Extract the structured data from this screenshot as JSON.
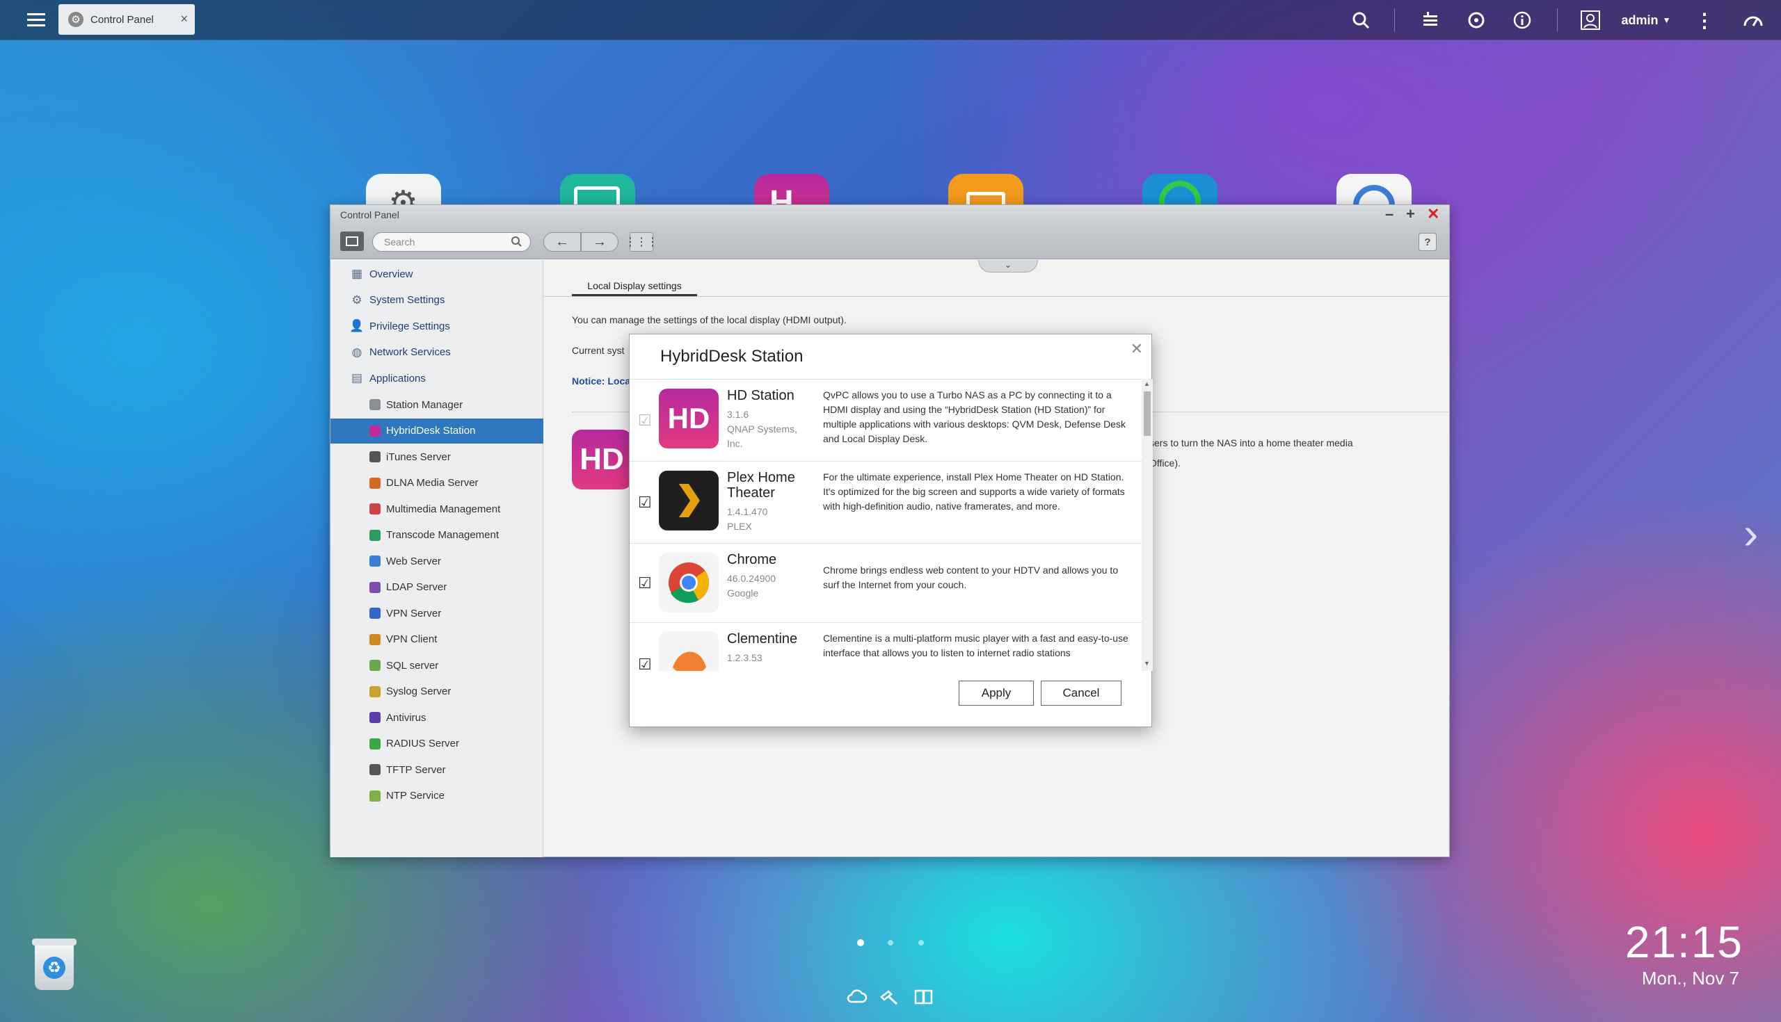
{
  "topbar": {
    "tab_label": "Control Panel",
    "user_label": "admin",
    "icons": [
      "menu-icon",
      "search-icon",
      "tasks-icon",
      "sync-icon",
      "info-icon",
      "user-icon",
      "more-icon",
      "dashboard-icon"
    ]
  },
  "window": {
    "title": "Control Panel",
    "search_placeholder": "Search",
    "help_label": "?",
    "tab_label": "Local Display settings",
    "intro": "You can manage the settings of the local display (HDMI output).",
    "current_prefix": "Current syst",
    "notice_prefix": "Notice: Loca",
    "side_text_1": "sers to turn the NAS into a home theater media",
    "side_text_2": "Office)."
  },
  "sidebar": {
    "top": [
      {
        "label": "Overview",
        "icon": "overview-icon"
      },
      {
        "label": "System Settings",
        "icon": "gear-icon"
      },
      {
        "label": "Privilege Settings",
        "icon": "user-icon"
      },
      {
        "label": "Network Services",
        "icon": "network-icon"
      },
      {
        "label": "Applications",
        "icon": "applications-icon"
      }
    ],
    "apps": [
      {
        "label": "Station Manager",
        "color": "#8a8f96"
      },
      {
        "label": "HybridDesk Station",
        "color": "#c42b9a",
        "selected": true
      },
      {
        "label": "iTunes Server",
        "color": "#555"
      },
      {
        "label": "DLNA Media Server",
        "color": "#d2691e"
      },
      {
        "label": "Multimedia Management",
        "color": "#cc4444"
      },
      {
        "label": "Transcode Management",
        "color": "#2a9d5c"
      },
      {
        "label": "Web Server",
        "color": "#3b7dd8"
      },
      {
        "label": "LDAP Server",
        "color": "#7a4fb0"
      },
      {
        "label": "VPN Server",
        "color": "#3068c8"
      },
      {
        "label": "VPN Client",
        "color": "#d08a1c"
      },
      {
        "label": "SQL server",
        "color": "#6aa84f"
      },
      {
        "label": "Syslog Server",
        "color": "#c9a227"
      },
      {
        "label": "Antivirus",
        "color": "#5b3ea8"
      },
      {
        "label": "RADIUS Server",
        "color": "#3aa845"
      },
      {
        "label": "TFTP Server",
        "color": "#555"
      },
      {
        "label": "NTP Service",
        "color": "#7cb342"
      }
    ]
  },
  "dialog": {
    "title": "HybridDesk Station",
    "apps": [
      {
        "name": "HD Station",
        "version": "3.1.6",
        "vendor": "QNAP Systems, Inc.",
        "checked": true,
        "disabled": true,
        "icon": "hd-station-icon",
        "description": "QvPC allows you to use a Turbo NAS as a PC by connecting it to a HDMI display and using the “HybridDesk Station (HD Station)” for multiple applications with various desktops: QVM Desk, Defense Desk and Local Display Desk."
      },
      {
        "name": "Plex Home Theater",
        "version": "1.4.1.470",
        "vendor": "PLEX",
        "checked": true,
        "icon": "plex-icon",
        "description": "For the ultimate experience, install Plex Home Theater on HD Station. It's optimized for the big screen and supports a wide variety of formats with high-definition audio, native framerates, and more."
      },
      {
        "name": "Chrome",
        "version": "46.0.24900",
        "vendor": "Google",
        "checked": true,
        "icon": "chrome-icon",
        "description": "Chrome brings endless web content to your HDTV and allows you to surf the Internet from your couch."
      },
      {
        "name": "Clementine",
        "version": "1.2.3.53",
        "vendor": "",
        "checked": true,
        "icon": "clementine-icon",
        "description": "Clementine is a multi-platform music player with a fast and easy-to-use interface that allows you to listen to internet radio stations"
      }
    ],
    "apply_label": "Apply",
    "cancel_label": "Cancel",
    "check_mark": "☑"
  },
  "desktop": {
    "time": "21:15",
    "date": "Mon., Nov 7",
    "page_dots": 3,
    "active_dot": 1
  }
}
